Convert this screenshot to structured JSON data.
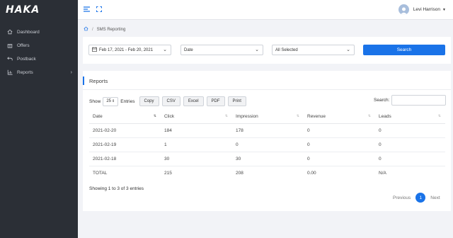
{
  "app": {
    "logo": "HAKA"
  },
  "sidebar": {
    "items": [
      {
        "label": "Dashboard",
        "icon": "home-icon"
      },
      {
        "label": "Offers",
        "icon": "gift-icon"
      },
      {
        "label": "Postback",
        "icon": "undo-icon"
      },
      {
        "label": "Reports",
        "icon": "chart-icon",
        "has_chevron": true
      }
    ]
  },
  "user": {
    "name": "Levi Harrison"
  },
  "breadcrumb": {
    "separator": "/",
    "current": "SMS Reporting"
  },
  "filters": {
    "date_range": "Feb 17, 2021 - Feb 20, 2021",
    "group_by": "Date",
    "selection": "All Selected",
    "search_label": "Search"
  },
  "report": {
    "title": "Reports",
    "show_label": "Show",
    "entries_value": "25",
    "entries_label": "Entries",
    "buttons": [
      "Copy",
      "CSV",
      "Excel",
      "PDF",
      "Print"
    ],
    "search_label": "Search:",
    "columns": [
      "Date",
      "Click",
      "Impression",
      "Revenue",
      "Leads"
    ],
    "rows": [
      [
        "2021-02-20",
        "184",
        "178",
        "0",
        "0"
      ],
      [
        "2021-02-19",
        "1",
        "0",
        "0",
        "0"
      ],
      [
        "2021-02-18",
        "30",
        "30",
        "0",
        "0"
      ]
    ],
    "total": [
      "TOTAL",
      "215",
      "208",
      "0.00",
      "N/A"
    ],
    "info": "Showing 1 to 3 of 3 entries",
    "pagination": {
      "previous": "Previous",
      "current": "1",
      "next": "Next"
    }
  },
  "colors": {
    "accent": "#1a73e8",
    "sidebar_bg": "#2b2f36",
    "page_bg": "#f2f3f7"
  }
}
